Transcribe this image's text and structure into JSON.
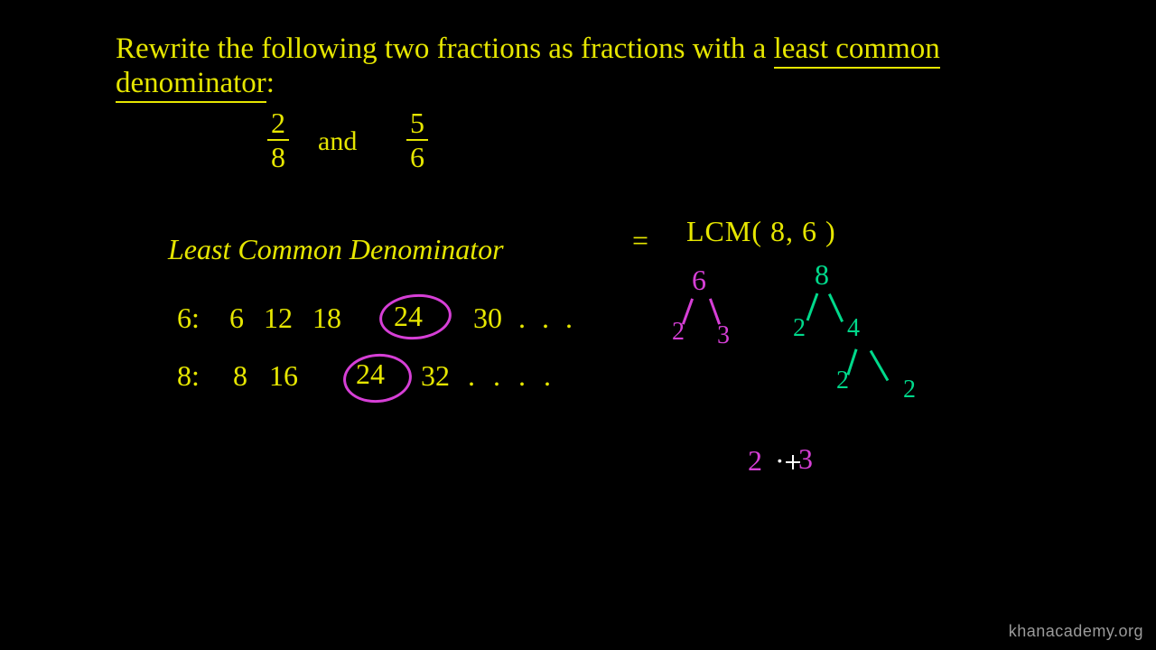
{
  "title": {
    "line1_pre": "Rewrite the following two fractions as fractions with a ",
    "line1_em": "least common",
    "line2_em": "denominator",
    "line2_post": ":"
  },
  "fractions": {
    "a_num": "2",
    "a_den": "8",
    "word_and": "and",
    "b_num": "5",
    "b_den": "6"
  },
  "lcd": {
    "label": "Least Common Denominator",
    "eq": "=",
    "rhs": "LCM( 8, 6 )"
  },
  "multiples": {
    "six_label": "6:",
    "six_list": "6   12   18",
    "six_lcm": "24",
    "six_rest": "30  . . .",
    "eight_label": "8:",
    "eight_list": "8   16",
    "eight_lcm": "24",
    "eight_rest": "32   . . .       ."
  },
  "tree6": {
    "root": "6",
    "l": "2",
    "r": "3"
  },
  "tree8": {
    "root": "8",
    "l": "2",
    "r": "4",
    "rl": "2",
    "rr": "2"
  },
  "product": {
    "a": "2",
    "dot": "·",
    "b": "3"
  },
  "watermark": "khanacademy.org"
}
